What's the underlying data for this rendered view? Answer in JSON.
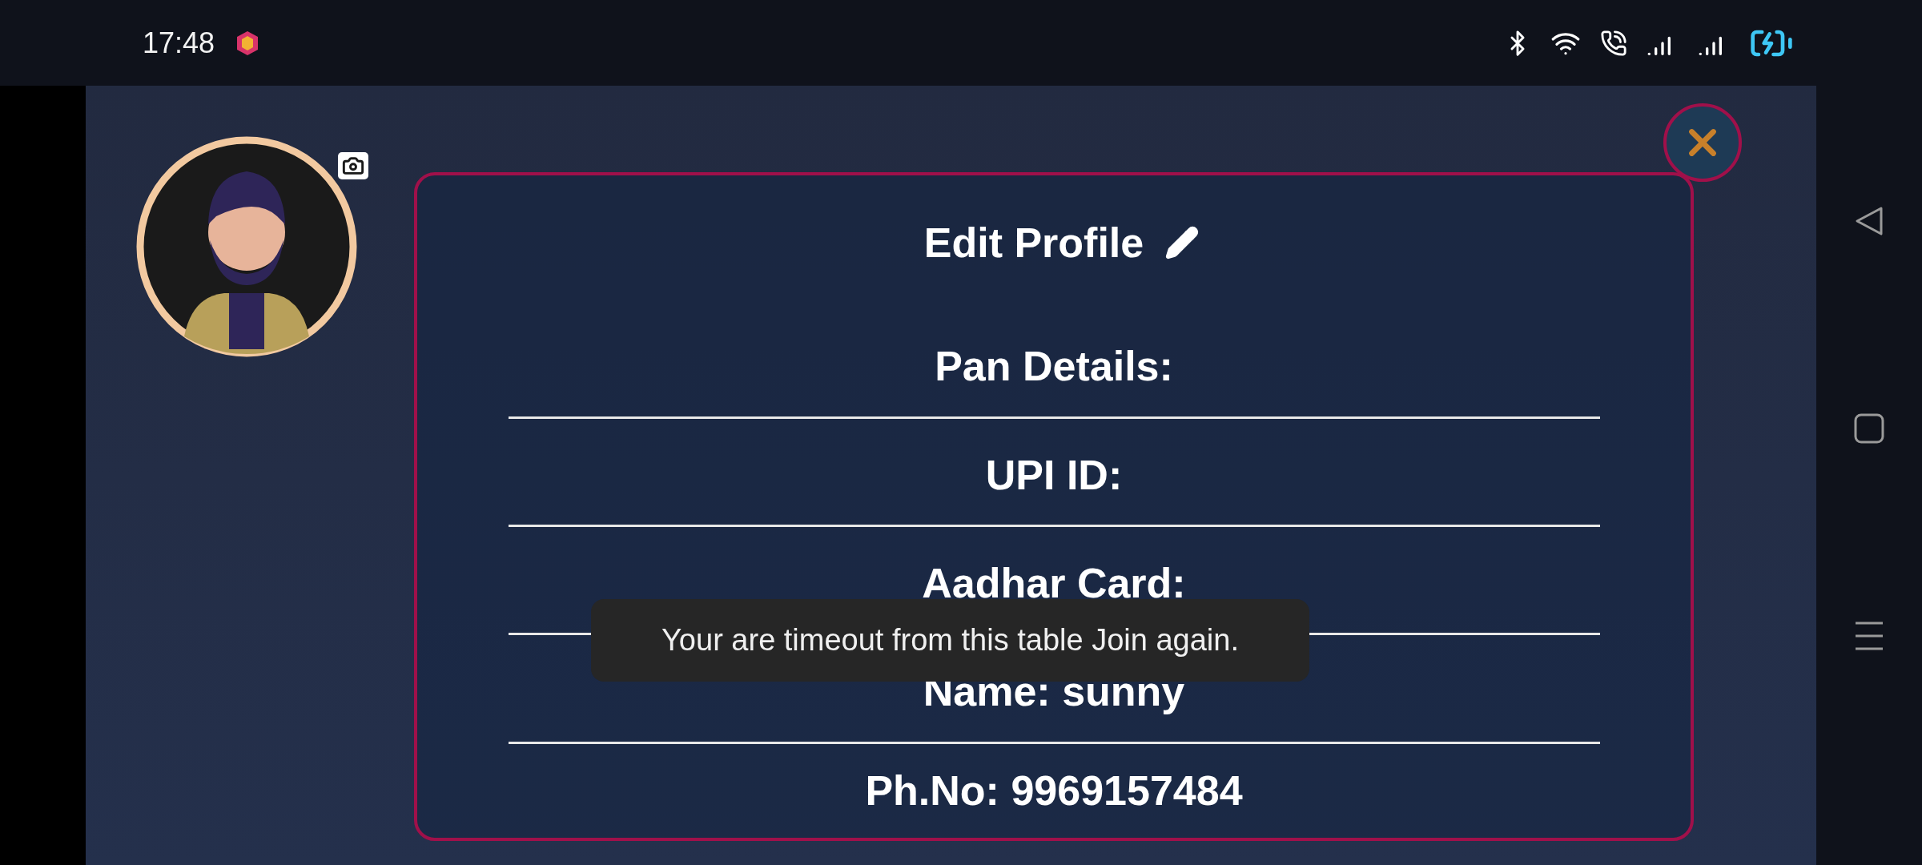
{
  "status_bar": {
    "time": "17:48"
  },
  "dialog": {
    "title": "Edit Profile",
    "fields": [
      {
        "label": "Pan Details:"
      },
      {
        "label": "UPI ID:"
      },
      {
        "label": "Aadhar Card:"
      },
      {
        "label": "Name: sunny"
      },
      {
        "label": "Ph.No: 9969157484"
      }
    ]
  },
  "toast": {
    "message": "Your are timeout from this table Join again."
  }
}
